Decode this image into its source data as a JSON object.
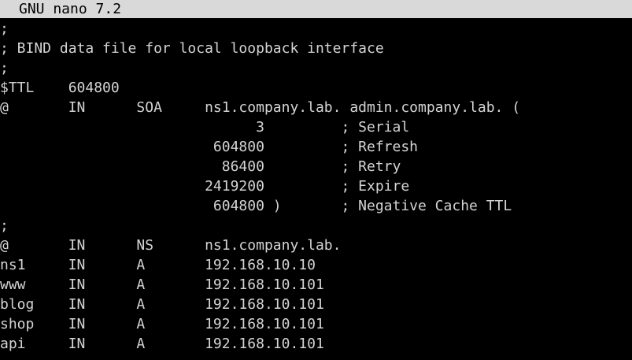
{
  "window": {
    "title": "GNU nano 7.2"
  },
  "colors": {
    "titlebar_bg": "#d9d9d9",
    "titlebar_fg": "#000000",
    "editor_bg": "#000000",
    "editor_fg": "#d4d4d4"
  },
  "file": {
    "lines": [
      ";",
      "; BIND data file for local loopback interface",
      ";",
      "$TTL    604800",
      "@       IN      SOA     ns1.company.lab. admin.company.lab. (",
      "                              3         ; Serial",
      "                         604800         ; Refresh",
      "                          86400         ; Retry",
      "                        2419200         ; Expire",
      "                         604800 )       ; Negative Cache TTL",
      ";",
      "@       IN      NS      ns1.company.lab.",
      "ns1     IN      A       192.168.10.10",
      "www     IN      A       192.168.10.101",
      "blog    IN      A       192.168.10.101",
      "shop    IN      A       192.168.10.101",
      "api     IN      A       192.168.10.101"
    ]
  }
}
